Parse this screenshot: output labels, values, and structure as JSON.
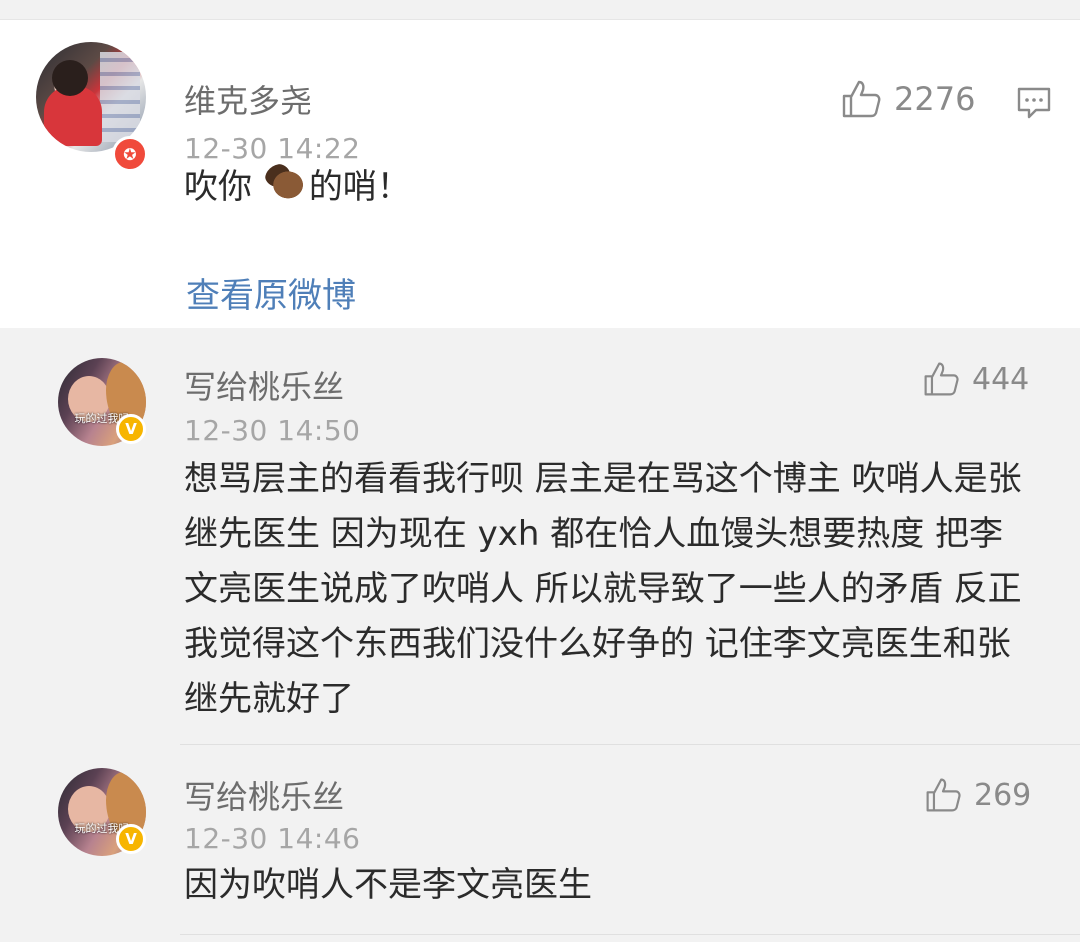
{
  "main_comment": {
    "username": "维克多尧",
    "timestamp": "12-30 14:22",
    "text_before_emoji": "吹你 ",
    "emoji": "horse-emoji",
    "text_after_emoji": "的哨！",
    "likes": "2276",
    "view_original_label": "查看原微博",
    "badge_icon": "star-badge-icon",
    "badge_color": "#f04a3b"
  },
  "replies": [
    {
      "username": "写给桃乐丝",
      "timestamp": "12-30 14:50",
      "likes": "444",
      "text": "想骂层主的看看我行呗 层主是在骂这个博主 吹哨人是张继先医生 因为现在 yxh 都在恰人血馒头想要热度 把李文亮医生说成了吹哨人 所以就导致了一些人的矛盾 反正我觉得这个东西我们没什么好争的 记住李文亮医生和张继先就好了",
      "avatar_caption": "玩的过我吗",
      "badge_color": "#f7b500"
    },
    {
      "username": "写给桃乐丝",
      "timestamp": "12-30 14:46",
      "likes": "269",
      "text": "因为吹哨人不是李文亮医生",
      "avatar_caption": "玩的过我吗",
      "badge_color": "#f7b500"
    }
  ],
  "colors": {
    "link": "#4f7fb8",
    "name": "#6d6d6d",
    "timestamp": "#a6a6a6",
    "body": "#2b2b2b",
    "reply_background": "#f2f2f2"
  }
}
